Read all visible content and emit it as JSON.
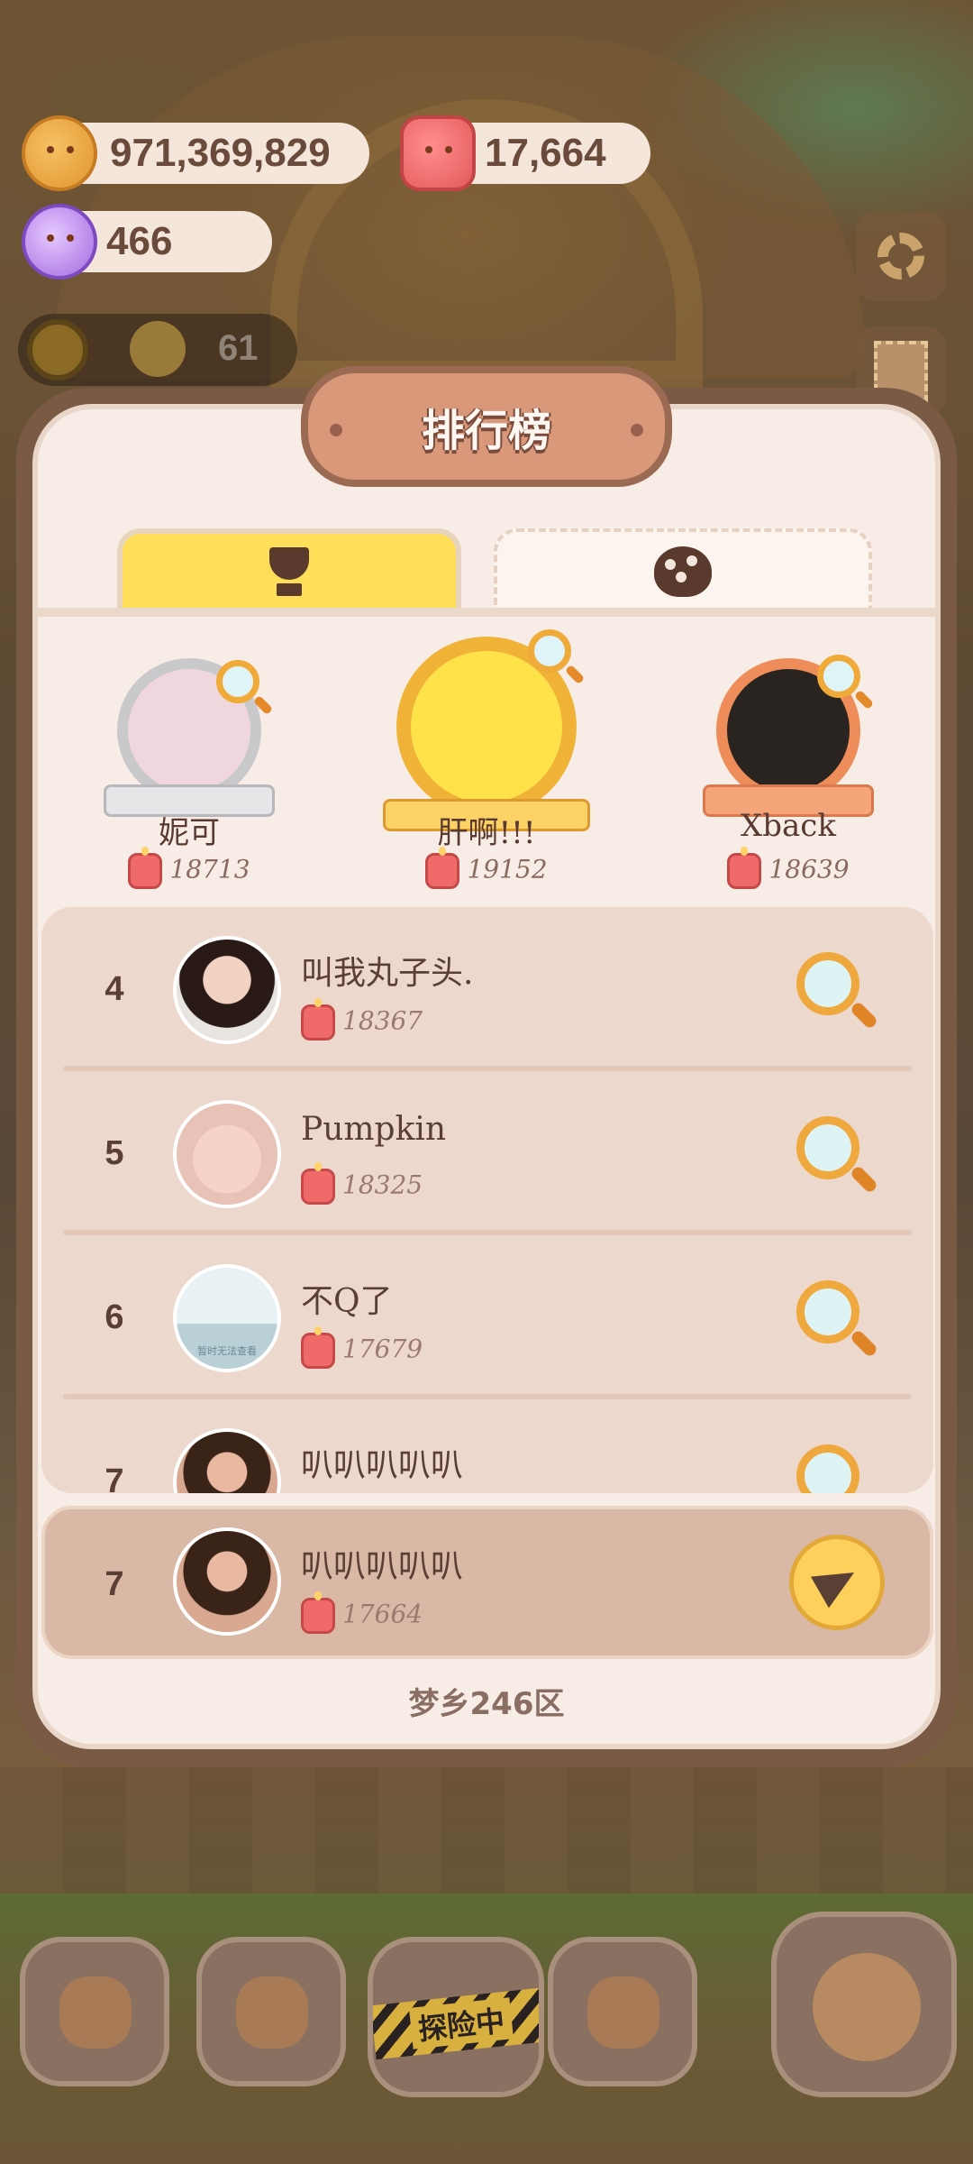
{
  "resources": {
    "cookies": "971,369,829",
    "candles": "17,664",
    "crystals": "466",
    "level": "61"
  },
  "leaderboard": {
    "title": "排行榜",
    "tabs": [
      {
        "icon": "trophy-icon",
        "selected": true
      },
      {
        "icon": "bomb-icon",
        "selected": false
      }
    ],
    "podium": [
      {
        "rank": 2,
        "name": "妮可",
        "score": "18713",
        "frame": "silver"
      },
      {
        "rank": 1,
        "name": "肝啊!!!",
        "score": "19152",
        "frame": "gold"
      },
      {
        "rank": 3,
        "name": "Xback",
        "score": "18639",
        "frame": "bronze"
      }
    ],
    "rows": [
      {
        "rank": "4",
        "name": "叫我丸子头.",
        "score": "18367"
      },
      {
        "rank": "5",
        "name": "Pumpkin",
        "score": "18325"
      },
      {
        "rank": "6",
        "name": "不Q了",
        "score": "17679",
        "avatar_text": "暂时无法查看"
      },
      {
        "rank": "7",
        "name": "叭叭叭叭叭",
        "score": ""
      }
    ],
    "self": {
      "rank": "7",
      "name": "叭叭叭叭叭",
      "score": "17664"
    },
    "server": "梦乡246区"
  },
  "bottom_nav": {
    "explore_label": "探险中"
  },
  "colors": {
    "panel": "#f7ede6",
    "tab_active": "#ffde5a",
    "accent_orange": "#eea83e",
    "text_brown": "#5a3f34"
  }
}
